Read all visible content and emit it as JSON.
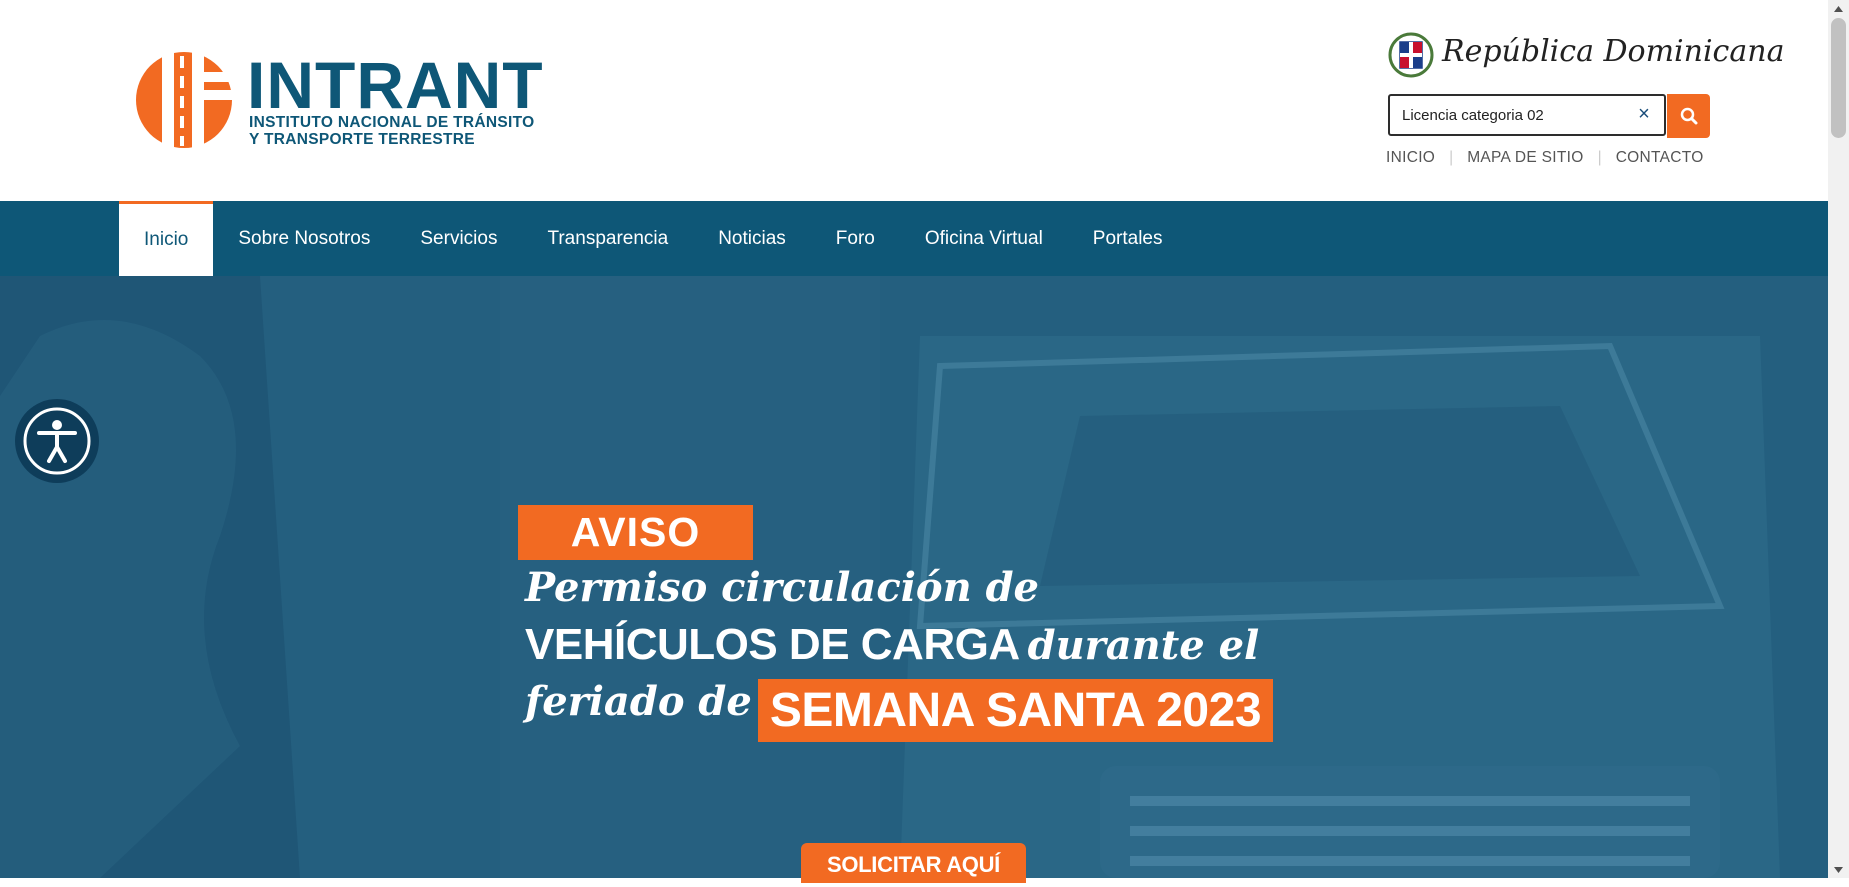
{
  "header": {
    "logo": {
      "title": "INTRANT",
      "subtitle_line1": "INSTITUTO NACIONAL DE TRÁNSITO",
      "subtitle_line2": "Y TRANSPORTE TERRESTRE"
    },
    "gov_badge": "República Dominicana",
    "search": {
      "value": "Licencia categoria 02",
      "clear_icon": "×"
    },
    "util_links": [
      "INICIO",
      "MAPA DE SITIO",
      "CONTACTO"
    ]
  },
  "nav": {
    "items": [
      "Inicio",
      "Sobre Nosotros",
      "Servicios",
      "Transparencia",
      "Noticias",
      "Foro",
      "Oficina Virtual",
      "Portales"
    ],
    "active": "Inicio"
  },
  "hero": {
    "badge": "AVISO",
    "line1": "Permiso circulación de",
    "line2_bold": "VEHÍCULOS DE CARGA",
    "line2_italic": "durante el",
    "line3_italic": "feriado de",
    "line3_highlight": "SEMANA SANTA 2023",
    "cta": "SOLICITAR AQUÍ"
  },
  "colors": {
    "brand_blue": "#0e5777",
    "brand_orange": "#f26a22",
    "hero_overlay": "#235f80"
  },
  "icons": {
    "search": "search-icon",
    "accessibility": "accessibility-icon",
    "clear": "close-icon"
  }
}
